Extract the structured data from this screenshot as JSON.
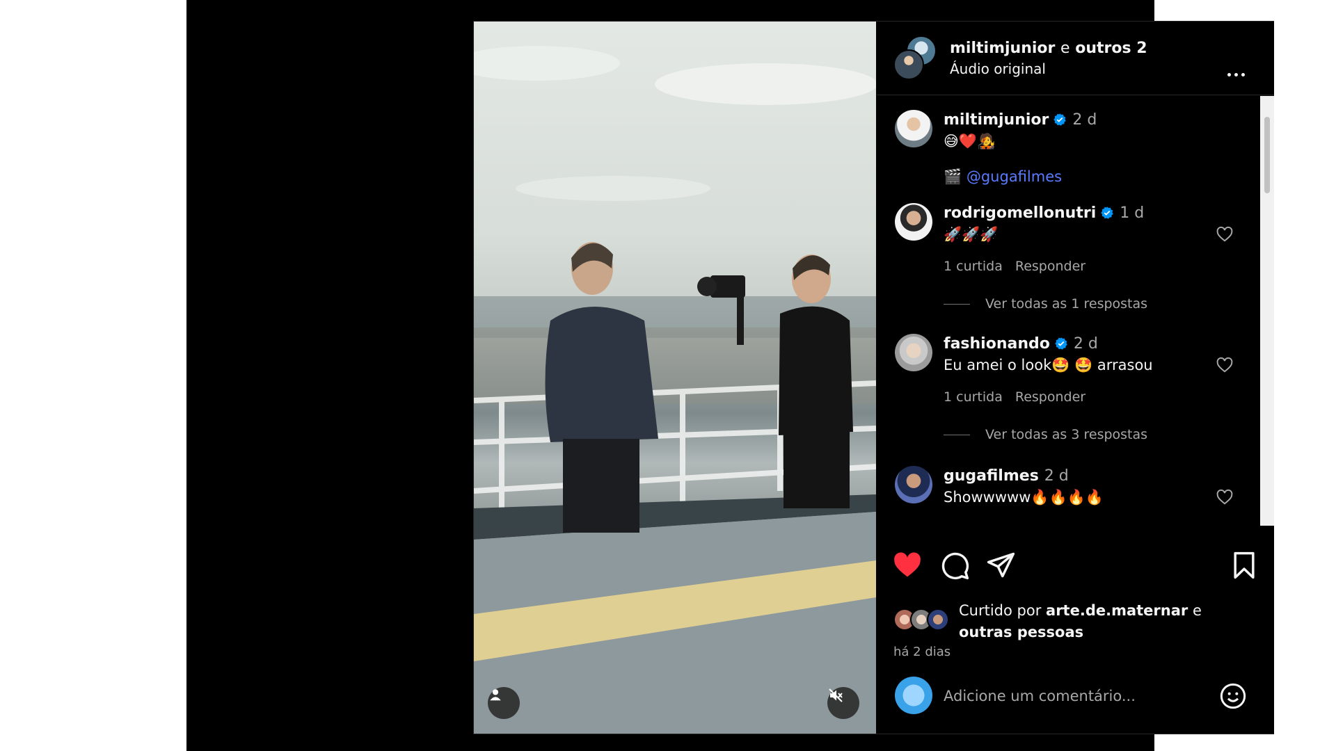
{
  "header": {
    "username": "miltimjunior",
    "connector": "e",
    "others": "outros 2",
    "audio": "Áudio original"
  },
  "comments": [
    {
      "username": "miltimjunior",
      "time": "2 d",
      "text": "😅❤️🧑‍🎤",
      "line2_prefix": "🎬",
      "mention": "@gugafilmes"
    },
    {
      "username": "rodrigomellonutri",
      "time": "1 d",
      "text": "🚀🚀🚀",
      "likes": "1 curtida",
      "reply": "Responder",
      "view_replies": "Ver todas as 1 respostas"
    },
    {
      "username": "fashionando",
      "time": "2 d",
      "text": "Eu amei o look🤩 🤩  arrasou",
      "likes": "1 curtida",
      "reply": "Responder",
      "view_replies": "Ver todas as 3 respostas"
    },
    {
      "username": "gugafilmes",
      "time": "2 d",
      "text": "Showwwww🔥🔥🔥🔥"
    }
  ],
  "liked_by": {
    "prefix": "Curtido por",
    "user": "arte.de.maternar",
    "connector": "e",
    "suffix": "outras pessoas"
  },
  "date": "há 2 dias",
  "comment_input": {
    "placeholder": "Adicione um comentário..."
  },
  "colors": {
    "liked_heart": "#ff3040",
    "verified": "#0095f6",
    "background": "#000000",
    "secondary_text": "#a8a8a8"
  },
  "icons": [
    "user-tag-icon",
    "mute-icon",
    "more-icon",
    "verified-icon",
    "heart-icon",
    "comment-icon",
    "share-icon",
    "bookmark-icon",
    "emoji-icon"
  ]
}
